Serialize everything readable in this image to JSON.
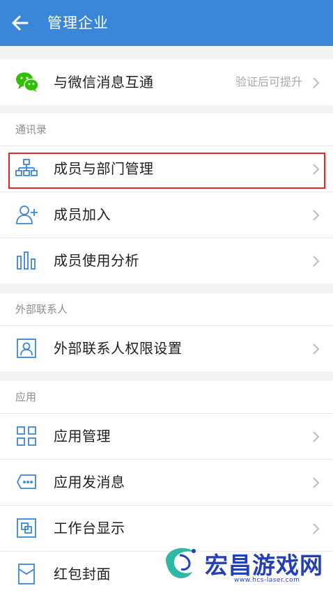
{
  "header": {
    "title": "管理企业"
  },
  "wechat_row": {
    "label": "与微信消息互通",
    "sub": "验证后可提升"
  },
  "contacts": {
    "section_label": "通讯录",
    "items": [
      {
        "label": "成员与部门管理"
      },
      {
        "label": "成员加入"
      },
      {
        "label": "成员使用分析"
      }
    ]
  },
  "external": {
    "section_label": "外部联系人",
    "items": [
      {
        "label": "外部联系人权限设置"
      }
    ]
  },
  "apps": {
    "section_label": "应用",
    "items": [
      {
        "label": "应用管理"
      },
      {
        "label": "应用发消息"
      },
      {
        "label": "工作台显示"
      },
      {
        "label": "红包封面"
      }
    ]
  },
  "watermark": {
    "text": "宏昌游戏网",
    "url": "www.hcs-laser.com"
  },
  "colors": {
    "appbar": "#3a86d8",
    "icon_blue": "#3a86d8",
    "wechat_green": "#2dc100",
    "highlight_red": "#e6242b"
  }
}
